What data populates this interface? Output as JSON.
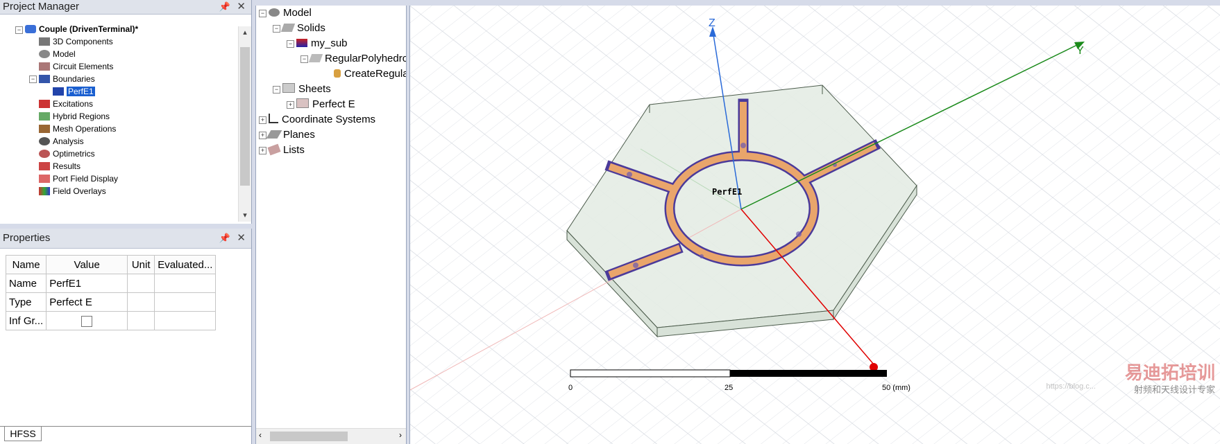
{
  "project_manager": {
    "title": "Project Manager",
    "items": [
      {
        "label": "Couple (DrivenTerminal)*",
        "icon": "hfss-design-icon"
      },
      {
        "label": "3D Components",
        "icon": "component-icon"
      },
      {
        "label": "Model",
        "icon": "model-icon"
      },
      {
        "label": "Circuit Elements",
        "icon": "circuit-icon"
      },
      {
        "label": "Boundaries",
        "icon": "boundary-icon"
      },
      {
        "label": "PerfE1",
        "icon": "perfe-icon"
      },
      {
        "label": "Excitations",
        "icon": "excitation-icon"
      },
      {
        "label": "Hybrid Regions",
        "icon": "hybrid-icon"
      },
      {
        "label": "Mesh Operations",
        "icon": "mesh-icon"
      },
      {
        "label": "Analysis",
        "icon": "analysis-icon"
      },
      {
        "label": "Optimetrics",
        "icon": "optimetrics-icon"
      },
      {
        "label": "Results",
        "icon": "results-icon"
      },
      {
        "label": "Port Field Display",
        "icon": "port-field-icon"
      },
      {
        "label": "Field Overlays",
        "icon": "field-overlay-icon"
      }
    ]
  },
  "properties": {
    "title": "Properties",
    "headers": [
      "Name",
      "Value",
      "Unit",
      "Evaluated..."
    ],
    "rows": [
      {
        "name": "Name",
        "value": "PerfE1",
        "unit": "",
        "evaluated": ""
      },
      {
        "name": "Type",
        "value": "Perfect E",
        "unit": "",
        "evaluated": ""
      },
      {
        "name": "Inf Gr...",
        "value": "",
        "unit": "",
        "evaluated": ""
      }
    ],
    "tab_label": "HFSS"
  },
  "model_tree": {
    "items": [
      {
        "label": "Model"
      },
      {
        "label": "Solids"
      },
      {
        "label": "my_sub"
      },
      {
        "label": "RegularPolyhedron"
      },
      {
        "label": "CreateRegularPolyhedron"
      },
      {
        "label": "Sheets"
      },
      {
        "label": "Perfect E"
      },
      {
        "label": "Coordinate Systems"
      },
      {
        "label": "Planes"
      },
      {
        "label": "Lists"
      }
    ]
  },
  "viewport": {
    "axis_z_label": "Z",
    "axis_y_label": "Y",
    "boundary_label": "PerfE1",
    "scale": {
      "ticks": [
        "0",
        "25",
        "50 (mm)"
      ]
    },
    "watermark_main": "易迪拓培训",
    "watermark_sub": "射频和天线设计专家",
    "watermark_url": "https://blog.c..."
  },
  "colors": {
    "axis_x": "#e00000",
    "axis_y": "#1a8a1a",
    "axis_z": "#2a6ad8",
    "substrate_fill": "#e8efe8",
    "conductor": "#e9a56b",
    "conductor_outline": "#4b3a9a",
    "selection": "#1a5fd0"
  }
}
